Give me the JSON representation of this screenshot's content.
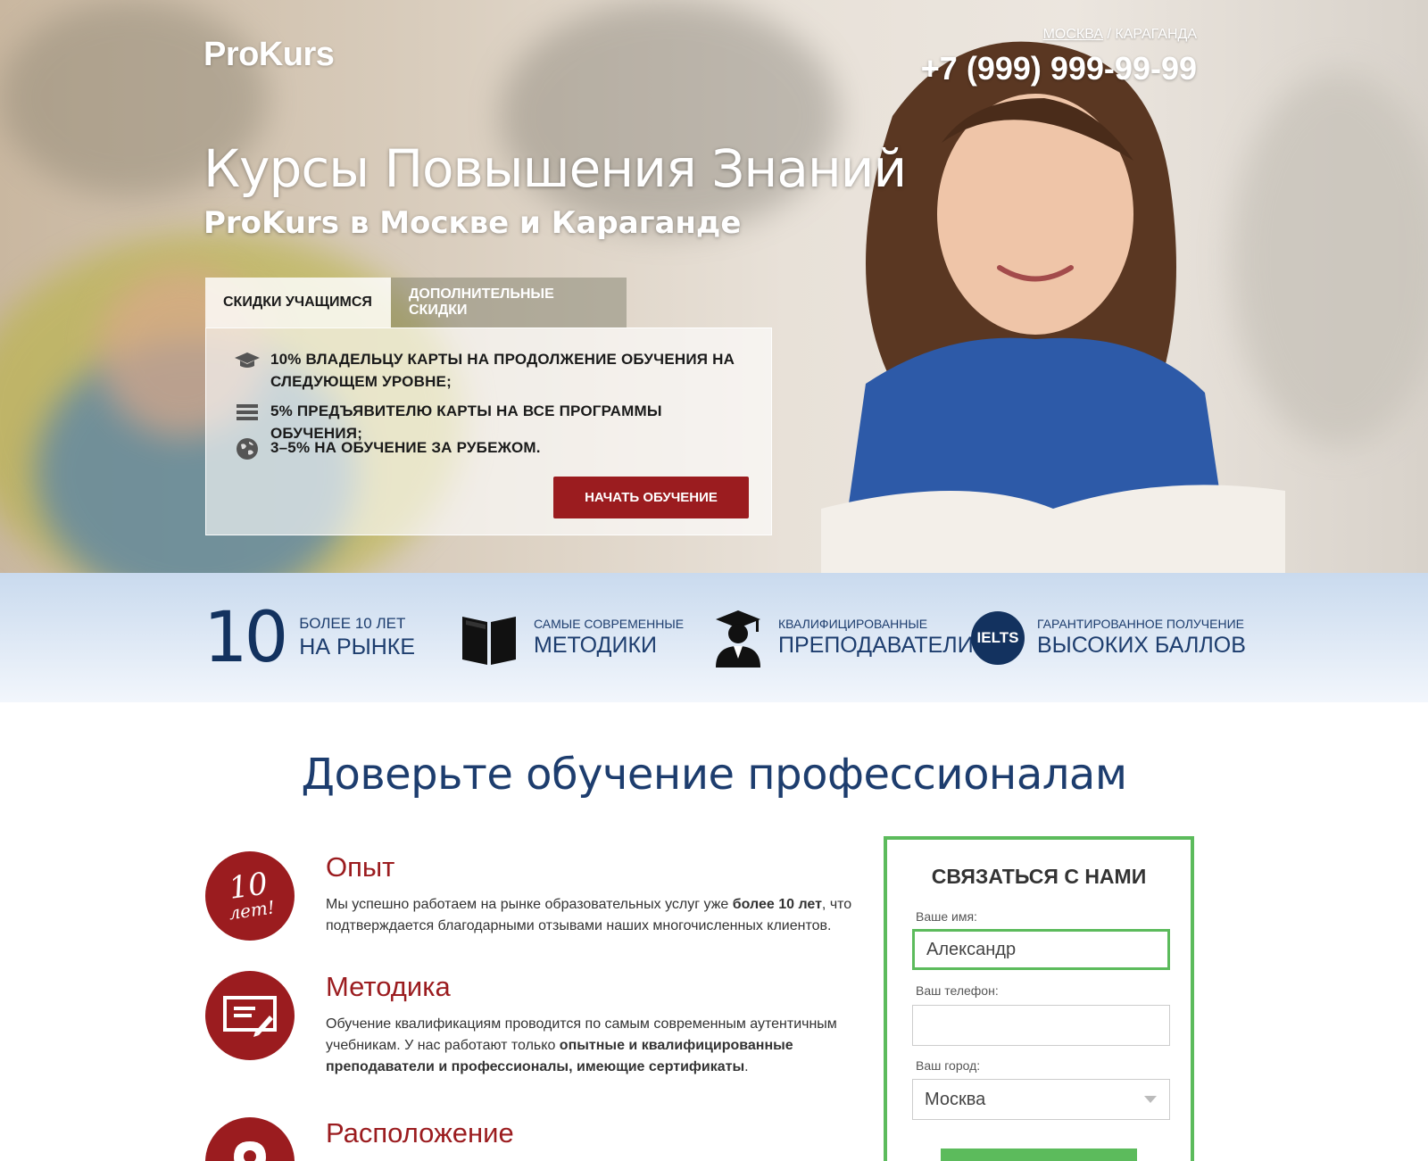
{
  "header": {
    "logo": "ProKurs",
    "city_active": "МОСКВА",
    "city_separator": " / ",
    "city_other": "КАРАГАНДА",
    "phone": "+7 (999) 999-99-99"
  },
  "hero": {
    "title": "Курсы Повышения Знаний",
    "subtitle": "ProKurs в Москве и Караганде",
    "tabs": [
      {
        "label": "СКИДКИ УЧАЩИМСЯ"
      },
      {
        "label": "ДОПОЛНИТЕЛЬНЫЕ СКИДКИ"
      }
    ],
    "items": [
      {
        "text": "10% ВЛАДЕЛЬЦУ КАРТЫ НА ПРОДОЛЖЕНИЕ ОБУЧЕНИЯ НА СЛЕДУЮЩЕМ УРОВНЕ;",
        "icon": "graduation-cap-icon"
      },
      {
        "text": "5% ПРЕДЪЯВИТЕЛЮ КАРТЫ НА ВСЕ ПРОГРАММЫ ОБУЧЕНИЯ;",
        "icon": "list-icon"
      },
      {
        "text": "3–5% НА ОБУЧЕНИЕ ЗА РУБЕЖОМ.",
        "icon": "globe-icon"
      }
    ],
    "cta": "НАЧАТЬ ОБУЧЕНИЕ"
  },
  "stats": [
    {
      "number": "10",
      "small": "БОЛЕЕ 10 ЛЕТ",
      "big": "НА РЫНКЕ"
    },
    {
      "small": "САМЫЕ СОВРЕМЕННЫЕ",
      "big": "МЕТОДИКИ",
      "icon": "book-icon"
    },
    {
      "small": "КВАЛИФИЦИРОВАННЫЕ",
      "big": "ПРЕПОДАВАТЕЛИ",
      "icon": "teacher-icon"
    },
    {
      "small": "ГАРАНТИРОВАННОЕ ПОЛУЧЕНИЕ",
      "big": "ВЫСОКИХ БАЛЛОВ",
      "badge": "IELTS"
    }
  ],
  "section": {
    "title": "Доверьте обучение профессионалам"
  },
  "features": [
    {
      "title": "Опыт",
      "badge_top": "10",
      "badge_bottom": "лет!",
      "text_before": "Мы успешно работаем на рынке образовательных услуг уже ",
      "text_bold": "более 10 лет",
      "text_after": ", что подтверждается благодарными отзывами наших многочисленных клиентов."
    },
    {
      "title": "Методика",
      "text_before": "Обучение квалификациям проводится по самым современным аутентичным учебникам. У нас работают только ",
      "text_bold": "опытные и квалифицированные преподаватели и профессионалы, имеющие сертификаты",
      "text_after": "."
    },
    {
      "title": "Расположение"
    }
  ],
  "form": {
    "title": "СВЯЗАТЬСЯ С НАМИ",
    "name_label": "Ваше имя:",
    "name_value": "Александр",
    "phone_label": "Ваш телефон:",
    "phone_value": "",
    "city_label": "Ваш город:",
    "city_value": "Москва"
  },
  "colors": {
    "accent_red": "#9b1c1f",
    "navy": "#1d3d6e",
    "green": "#5cbb5c"
  }
}
